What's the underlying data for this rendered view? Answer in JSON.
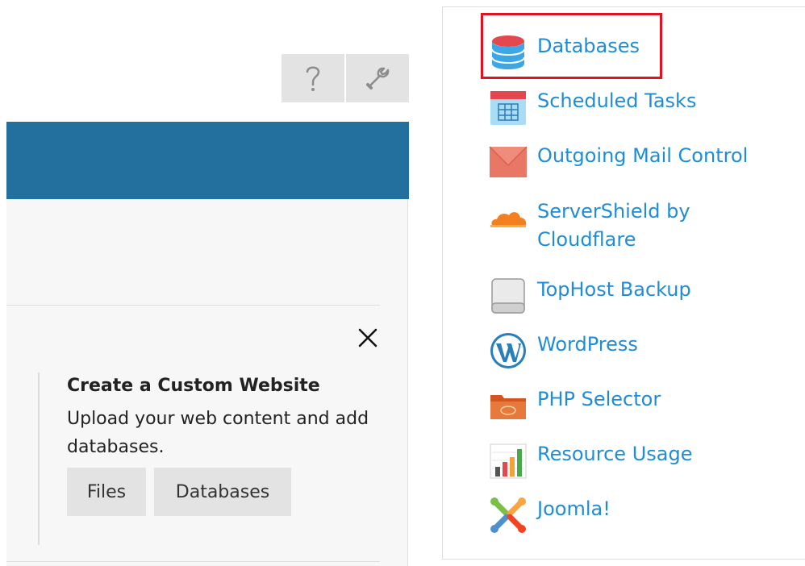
{
  "toolbar": {
    "help_icon": "question-mark-icon",
    "settings_icon": "wrench-icon"
  },
  "card": {
    "title": "Create a Custom Website",
    "description": "Upload your web content and add databases.",
    "buttons": {
      "files": "Files",
      "databases": "Databases"
    }
  },
  "menu": {
    "items": [
      {
        "label": "Databases",
        "icon": "database-icon",
        "highlighted": true
      },
      {
        "label": "Scheduled Tasks",
        "icon": "calendar-icon"
      },
      {
        "label": "Outgoing Mail Control",
        "icon": "envelope-icon"
      },
      {
        "label": "ServerShield by Cloudflare",
        "icon": "cloud-icon"
      },
      {
        "label": "TopHost Backup",
        "icon": "backup-drive-icon"
      },
      {
        "label": "WordPress",
        "icon": "wordpress-icon"
      },
      {
        "label": "PHP Selector",
        "icon": "php-folder-icon"
      },
      {
        "label": "Resource Usage",
        "icon": "bar-chart-icon"
      },
      {
        "label": "Joomla!",
        "icon": "joomla-icon"
      }
    ]
  },
  "colors": {
    "banner": "#23709e",
    "link": "#1f8dd6",
    "highlight": "#e0141f"
  }
}
